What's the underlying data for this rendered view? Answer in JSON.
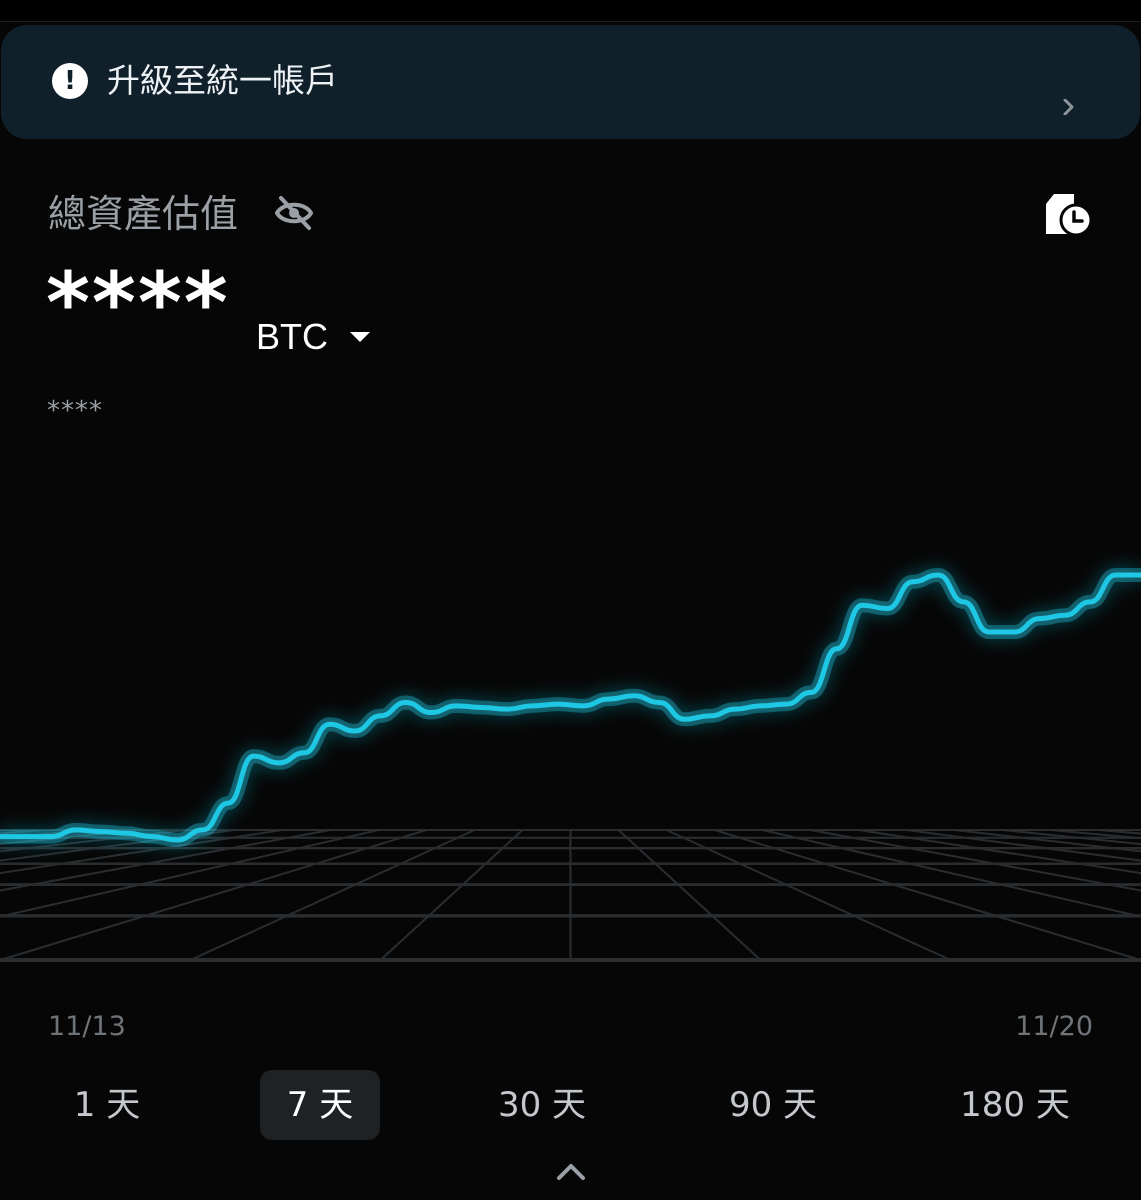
{
  "banner": {
    "icon": "alert-circle-icon",
    "text": "升級至統一帳戶",
    "chevron": "chevron-right-icon"
  },
  "header": {
    "total_label": "總資產估值",
    "visibility_icon": "eye-off-icon",
    "history_icon": "history-icon"
  },
  "balance": {
    "main": "****",
    "currency": "BTC",
    "sub": "****"
  },
  "chart_data": {
    "type": "line",
    "title": "",
    "xlabel": "",
    "ylabel": "",
    "x_start_label": "11/13",
    "x_end_label": "11/20",
    "line_color": "#1ec8e4",
    "grid": true,
    "values": [
      100,
      100,
      100,
      104,
      103,
      102,
      100,
      98,
      104,
      120,
      148,
      144,
      150,
      167,
      163,
      172,
      180,
      174,
      178,
      177,
      176,
      178,
      179,
      178,
      182,
      184,
      180,
      170,
      172,
      176,
      178,
      179,
      186,
      212,
      238,
      236,
      252,
      256,
      240,
      222,
      222,
      230,
      232,
      240,
      256,
      256
    ]
  },
  "dates": {
    "start": "11/13",
    "end": "11/20"
  },
  "ranges": [
    {
      "label": "1 天",
      "active": false
    },
    {
      "label": "7 天",
      "active": true
    },
    {
      "label": "30 天",
      "active": false
    },
    {
      "label": "90 天",
      "active": false
    },
    {
      "label": "180 天",
      "active": false
    }
  ],
  "expand_icon": "chevron-up-icon"
}
